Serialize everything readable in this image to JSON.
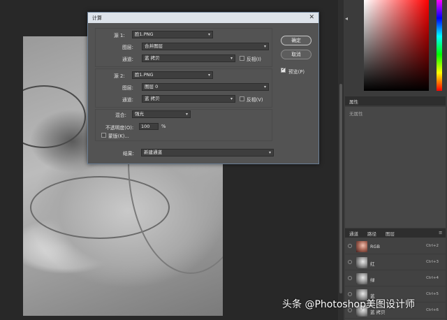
{
  "dialog": {
    "title": "计算",
    "close_glyph": "✕",
    "source1": {
      "label": "源 1:",
      "file": "脸1.PNG",
      "layer_label": "图层:",
      "layer": "合并图层",
      "channel_label": "通道:",
      "channel": "蓝 拷贝",
      "invert_label": "反相(I)",
      "invert_checked": false
    },
    "source2": {
      "label": "源 2:",
      "file": "脸1.PNG",
      "layer_label": "图层:",
      "layer": "图层 0",
      "channel_label": "通道:",
      "channel": "蓝 拷贝",
      "invert_label": "反相(V)",
      "invert_checked": false
    },
    "blending": {
      "label": "混合:",
      "mode": "强光",
      "opacity_label": "不透明度(O):",
      "opacity": "100",
      "opacity_unit": "%",
      "mask_label": "蒙版(K)...",
      "mask_checked": false
    },
    "result": {
      "label": "结果:",
      "value": "新建通道"
    },
    "ok_label": "确定",
    "cancel_label": "取消",
    "preview_label": "预览(P)",
    "preview_checked": true
  },
  "panels": {
    "properties": {
      "tab": "属性",
      "empty_text": "无属性"
    },
    "tabs": [
      "通道",
      "路径",
      "图层"
    ],
    "channels": [
      {
        "name": "RGB",
        "shortcut": "Ctrl+2",
        "color": true
      },
      {
        "name": "红",
        "shortcut": "Ctrl+3",
        "color": false
      },
      {
        "name": "绿",
        "shortcut": "Ctrl+4",
        "color": false
      },
      {
        "name": "蓝",
        "shortcut": "Ctrl+5",
        "color": false
      },
      {
        "name": "蓝 拷贝",
        "shortcut": "Ctrl+6",
        "color": false
      }
    ]
  },
  "watermark": "头条 @Photoshop美图设计师",
  "colors": {
    "dialog_bg": "#535353",
    "titlebar": "#dde3ea",
    "panel_bg": "#3b3b3b"
  }
}
